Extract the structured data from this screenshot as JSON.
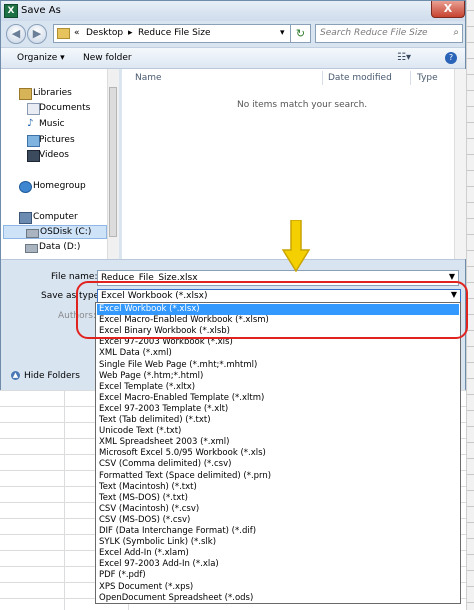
{
  "window": {
    "title": "Save As",
    "close_label": "X",
    "app_icon_letter": "X"
  },
  "nav": {
    "back_glyph": "◀",
    "forward_glyph": "▶",
    "breadcrumb": [
      "«",
      "Desktop",
      "▸",
      "Reduce File Size",
      "▾"
    ],
    "refresh_glyph": "↻",
    "search_placeholder": "Search Reduce File Size"
  },
  "toolbar": {
    "organize": "Organize ▾",
    "new_folder": "New folder",
    "help": "?"
  },
  "sidebar": [
    {
      "label": "Libraries"
    },
    {
      "label": "Documents"
    },
    {
      "label": "Music"
    },
    {
      "label": "Pictures"
    },
    {
      "label": "Videos"
    },
    {
      "label": "Homegroup"
    },
    {
      "label": "Computer"
    },
    {
      "label": "OSDisk (C:)"
    },
    {
      "label": "Data (D:)"
    }
  ],
  "file_list": {
    "columns": [
      "Name",
      "Date modified",
      "Type"
    ],
    "empty_message": "No items match your search."
  },
  "form": {
    "file_name_label": "File name:",
    "file_name_value": "Reduce_File_Size.xlsx",
    "save_type_label": "Save as type:",
    "save_type_value": "Excel Workbook (*.xlsx)",
    "authors_label": "Authors:",
    "hide_folders": "Hide Folders"
  },
  "dropdown_options": [
    "Excel Workbook (*.xlsx)",
    "Excel Macro-Enabled Workbook (*.xlsm)",
    "Excel Binary Workbook (*.xlsb)",
    "Excel 97-2003 Workbook (*.xls)",
    "XML Data (*.xml)",
    "Single File Web Page (*.mht;*.mhtml)",
    "Web Page (*.htm;*.html)",
    "Excel Template (*.xltx)",
    "Excel Macro-Enabled Template (*.xltm)",
    "Excel 97-2003 Template (*.xlt)",
    "Text (Tab delimited) (*.txt)",
    "Unicode Text (*.txt)",
    "XML Spreadsheet 2003 (*.xml)",
    "Microsoft Excel 5.0/95 Workbook (*.xls)",
    "CSV (Comma delimited) (*.csv)",
    "Formatted Text (Space delimited) (*.prn)",
    "Text (Macintosh) (*.txt)",
    "Text (MS-DOS) (*.txt)",
    "CSV (Macintosh) (*.csv)",
    "CSV (MS-DOS) (*.csv)",
    "DIF (Data Interchange Format) (*.dif)",
    "SYLK (Symbolic Link) (*.slk)",
    "Excel Add-In (*.xlam)",
    "Excel 97-2003 Add-In (*.xla)",
    "PDF (*.pdf)",
    "XPS Document (*.xps)",
    "OpenDocument Spreadsheet (*.ods)"
  ],
  "colors": {
    "accent": "#3399ff",
    "annotation": "#e0231e",
    "arrow": "#f5d000"
  }
}
